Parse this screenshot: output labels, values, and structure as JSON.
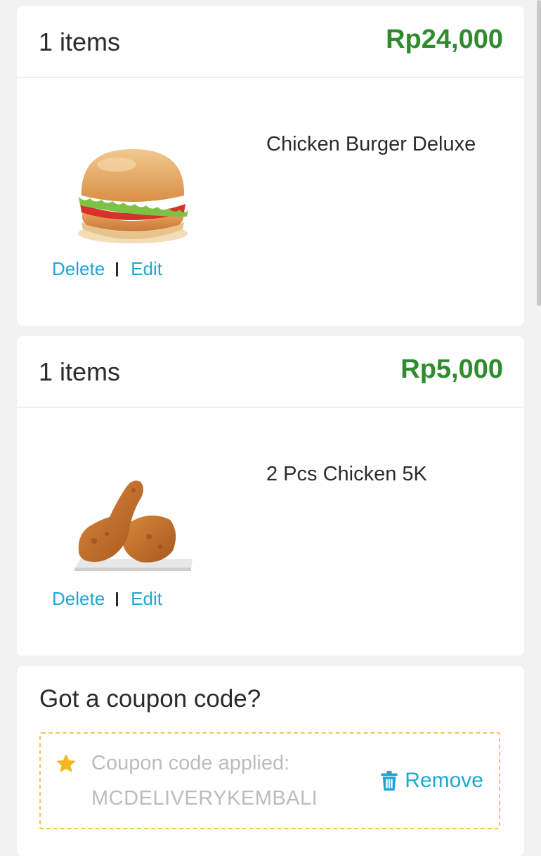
{
  "cart": {
    "items": [
      {
        "count_label": "1 items",
        "price": "Rp24,000",
        "name": "Chicken Burger Deluxe",
        "image_icon": "burger-image",
        "delete_label": "Delete",
        "edit_label": "Edit"
      },
      {
        "count_label": "1 items",
        "price": "Rp5,000",
        "name": "2 Pcs Chicken 5K",
        "image_icon": "fried-chicken-image",
        "delete_label": "Delete",
        "edit_label": "Edit"
      }
    ]
  },
  "coupon": {
    "title": "Got a coupon code?",
    "applied_label": "Coupon code applied:",
    "code": "MCDELIVERYKEMBALI",
    "remove_label": "Remove",
    "star_icon": "star-icon",
    "remove_icon": "trash-icon"
  },
  "colors": {
    "price_green": "#2e8b2e",
    "action_blue": "#1aa9d6",
    "coupon_border": "#f0c75a",
    "star_yellow": "#f5b820"
  }
}
